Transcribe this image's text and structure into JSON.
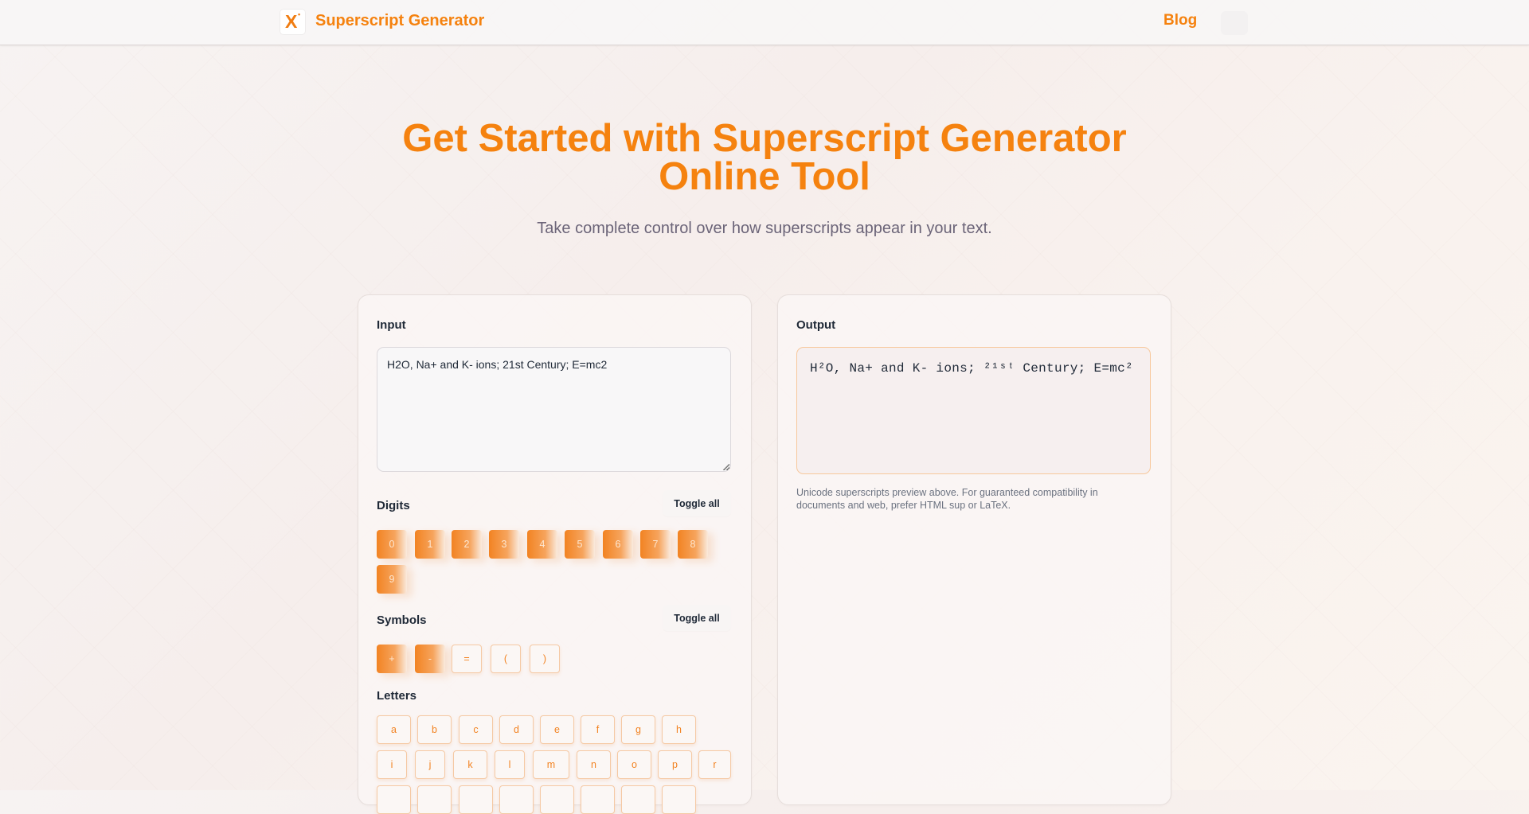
{
  "header": {
    "logo_x": "X",
    "logo_sup": "•",
    "brand": "Superscript Generator",
    "nav_blog": "Blog"
  },
  "hero": {
    "title_line1": "Get Started with Superscript Generator",
    "title_line2": "Online Tool",
    "subtitle": "Take complete control over how superscripts appear in your text."
  },
  "input_panel": {
    "label": "Input",
    "value": "H2O, Na+ and K- ions; 21st Century; E=mc2",
    "digits": {
      "title": "Digits",
      "toggle_label": "Toggle all",
      "items": [
        "0",
        "1",
        "2",
        "3",
        "4",
        "5",
        "6",
        "7",
        "8",
        "9"
      ]
    },
    "symbols": {
      "title": "Symbols",
      "toggle_label": "Toggle all",
      "items": [
        "+",
        "-",
        "=",
        "(",
        ")"
      ],
      "selected": [
        "+",
        "-"
      ]
    },
    "letters": {
      "title": "Letters",
      "items": [
        "a",
        "b",
        "c",
        "d",
        "e",
        "f",
        "g",
        "h",
        "i",
        "j",
        "k",
        "l",
        "m",
        "n",
        "o",
        "p",
        "r"
      ]
    }
  },
  "output_panel": {
    "label": "Output",
    "value": "H²O, Na+ and K- ions; ²¹ˢᵗ Century; E=mc²",
    "hint": "Unicode superscripts preview above. For guaranteed compatibility in documents and web, prefer HTML sup or LaTeX."
  },
  "colors": {
    "accent": "#f5820f",
    "chip_border": "#f5c9a4",
    "output_border": "#f7c89c"
  }
}
